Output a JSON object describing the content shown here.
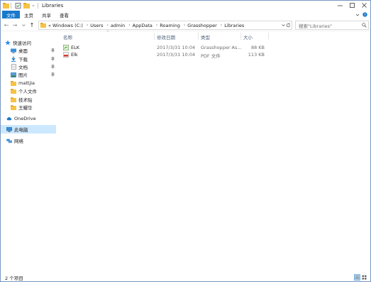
{
  "window": {
    "title": "Libraries"
  },
  "ribbon": {
    "tabs": [
      "文件",
      "主页",
      "共享",
      "查看"
    ]
  },
  "address": {
    "back_label": "←",
    "forward_label": "→",
    "up_label": "↑",
    "chevron": "«",
    "crumbs": [
      "Windows (C:)",
      "Users",
      "admin",
      "AppData",
      "Roaming",
      "Grasshopper",
      "Libraries"
    ]
  },
  "search": {
    "placeholder": "搜索\"Libraries\""
  },
  "nav": {
    "quick_access": "快速访问",
    "items": [
      "桌面",
      "下载",
      "文档",
      "图片",
      "mattjia",
      "个人文件",
      "技术贴",
      "王耀华"
    ],
    "onedrive": "OneDrive",
    "this_pc": "此电脑",
    "network": "网络"
  },
  "columns": {
    "name": "名称",
    "date": "修改日期",
    "type": "类型",
    "size": "大小"
  },
  "files": [
    {
      "name": "ELK",
      "date": "2017/3/31 10:04",
      "type": "Grasshopper As...",
      "size": "88 KB",
      "icon": "grasshopper-assembly-icon"
    },
    {
      "name": "Elk",
      "date": "2017/3/31 10:04",
      "type": "PDF 文件",
      "size": "113 KB",
      "icon": "pdf-file-icon"
    }
  ],
  "status": {
    "count": "2 个项目"
  },
  "colors": {
    "accent": "#1979ca",
    "selected_bg": "#cce8ff",
    "folder": "#f6c344"
  }
}
